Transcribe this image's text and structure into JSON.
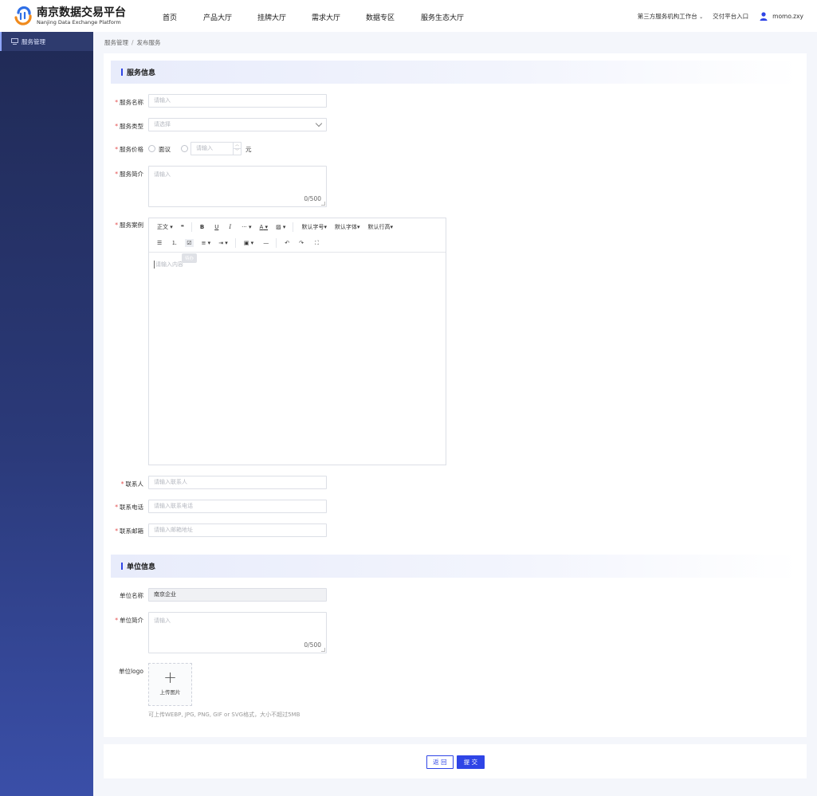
{
  "header": {
    "logo_title": "南京数据交易平台",
    "logo_subtitle": "Nanjing Data Exchange Platform",
    "nav": [
      "首页",
      "产品大厅",
      "挂牌大厅",
      "需求大厅",
      "数据专区",
      "服务生态大厅"
    ],
    "workbench": "第三方服务机构工作台",
    "delivery": "交付平台入口",
    "username": "momo.zxy"
  },
  "sidebar": {
    "items": [
      {
        "label": "服务管理",
        "icon": "service-manage-icon"
      }
    ]
  },
  "breadcrumb": {
    "root": "服务管理",
    "separator": "/",
    "current": "发布服务"
  },
  "service_section": {
    "title": "服务信息",
    "name": {
      "label": "服务名称",
      "placeholder": "请输入"
    },
    "type": {
      "label": "服务类型",
      "placeholder": "请选择"
    },
    "price": {
      "label": "服务价格",
      "option_negotiable": "面议",
      "placeholder": "请输入",
      "unit": "元"
    },
    "intro": {
      "label": "服务简介",
      "placeholder": "请输入",
      "count": "0/500"
    },
    "case": {
      "label": "服务案例",
      "editor_placeholder": "请输入内容",
      "toolbar_row1": [
        "正文",
        "❝",
        "B",
        "U",
        "I",
        "···",
        "A",
        "▨",
        "默认字号",
        "默认字体",
        "默认行高"
      ],
      "toolbar_row2": [
        "☰",
        "⒈",
        "☑",
        "≡",
        "⇥",
        "▣",
        "—",
        "↶",
        "↷",
        "⛶"
      ],
      "tooltip": "待办"
    },
    "contact": {
      "label": "联系人",
      "placeholder": "请输入联系人"
    },
    "phone": {
      "label": "联系电话",
      "placeholder": "请输入联系电话"
    },
    "email": {
      "label": "联系邮箱",
      "placeholder": "请输入邮箱地址"
    }
  },
  "unit_section": {
    "title": "单位信息",
    "name": {
      "label": "单位名称",
      "value": "南京企业"
    },
    "intro": {
      "label": "单位简介",
      "placeholder": "请输入",
      "count": "0/500"
    },
    "logo": {
      "label": "单位logo",
      "upload_text": "上传图片",
      "plus": "+",
      "hint": "可上传WEBP, JPG, PNG, GIF or SVG格式，大小不超过5MB"
    }
  },
  "actions": {
    "back": "返 回",
    "submit": "提 交"
  },
  "colors": {
    "primary": "#2f45e6",
    "required": "#e34d4d",
    "sidebar": "#2b3a7a"
  }
}
